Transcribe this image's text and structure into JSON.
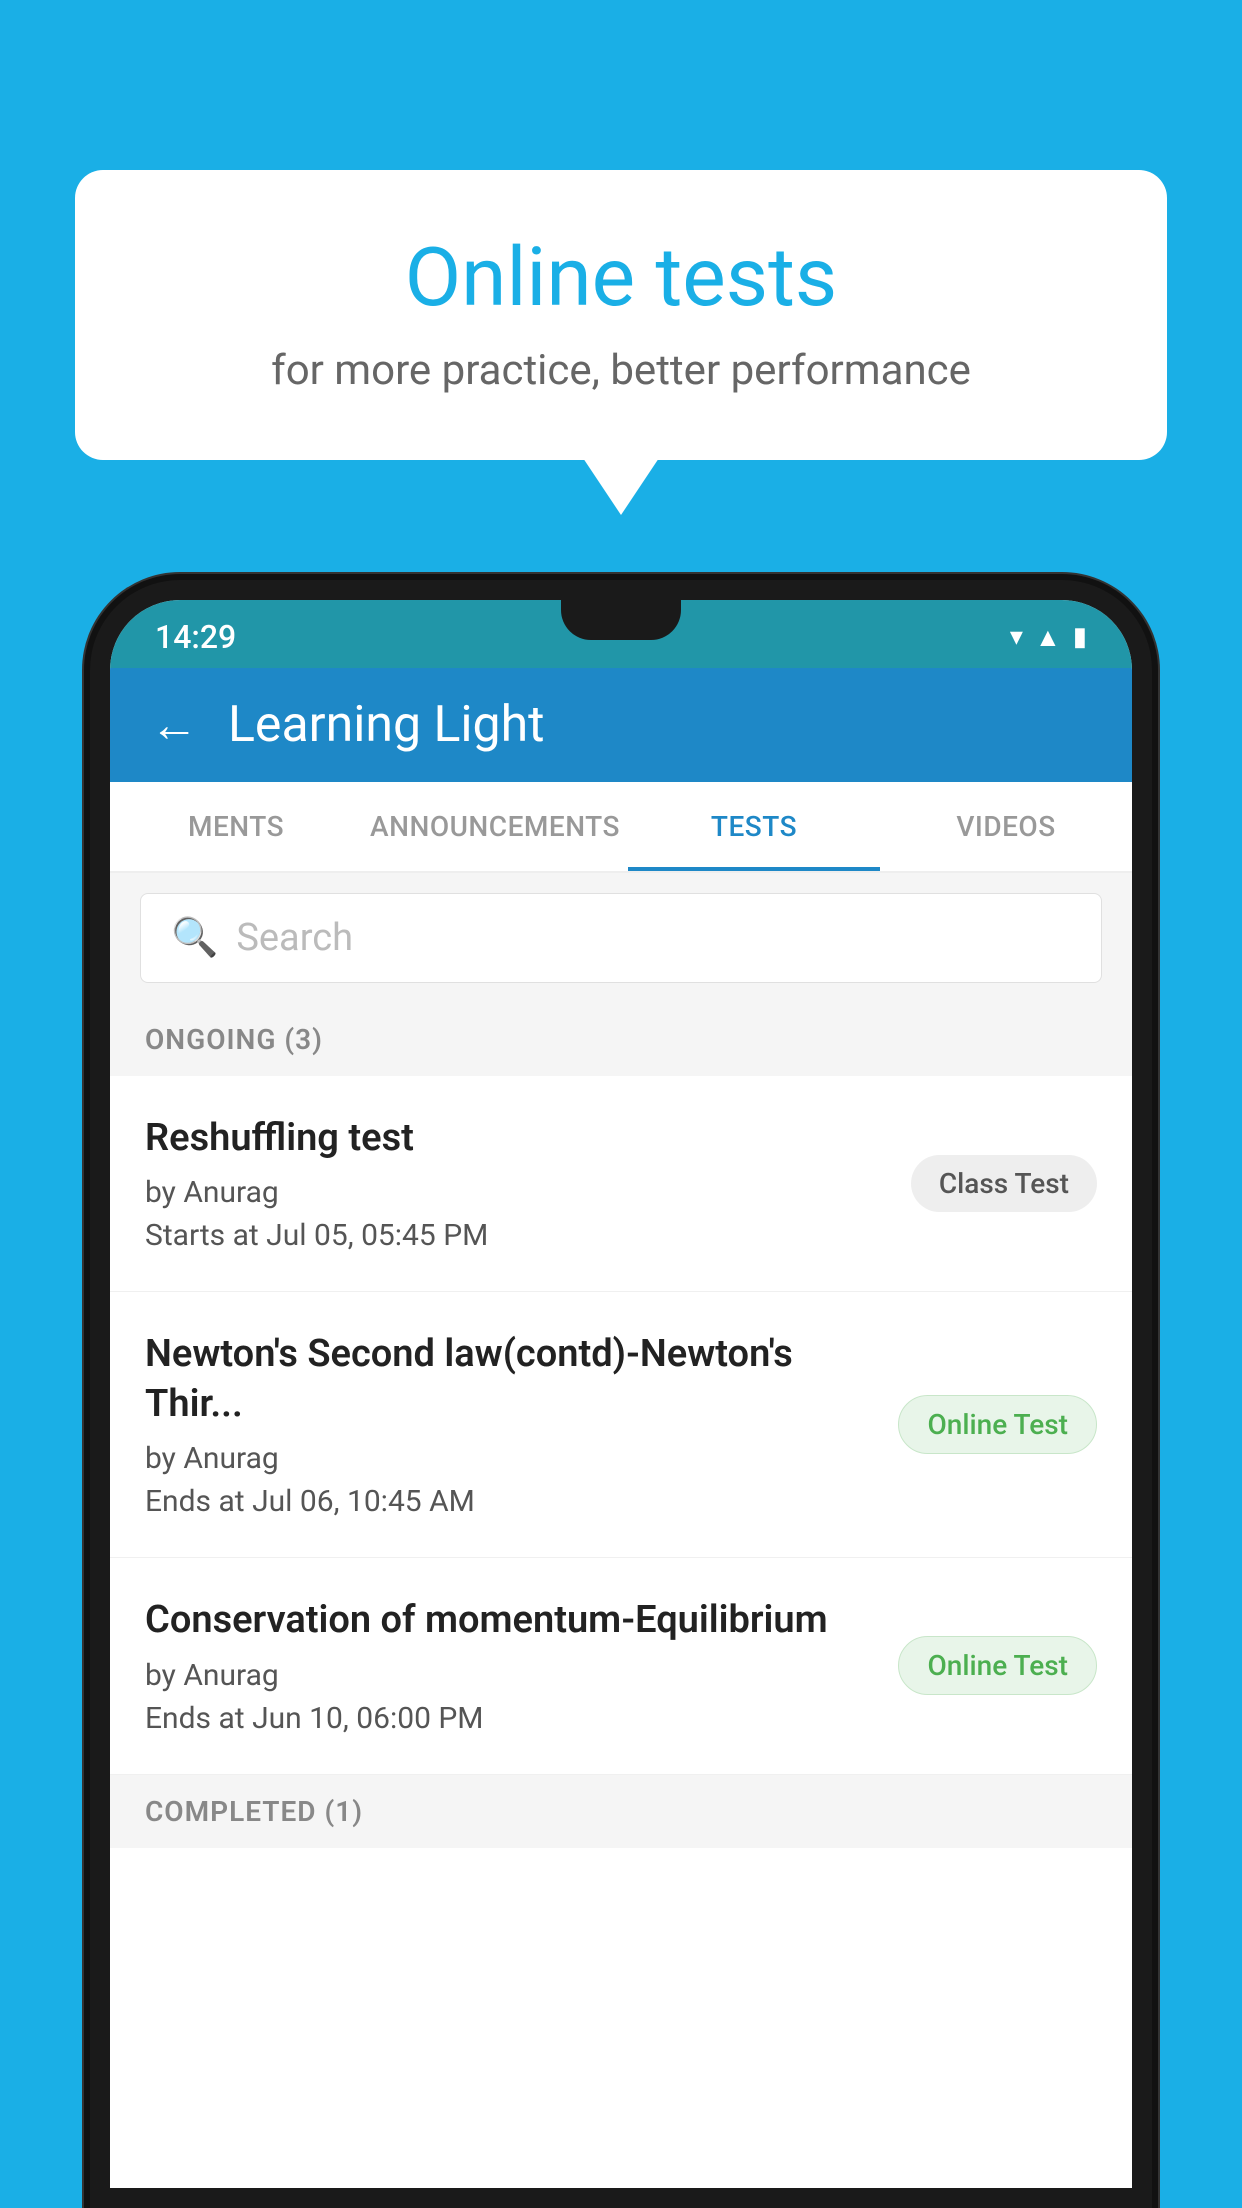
{
  "background": {
    "color": "#1AAFE6"
  },
  "speech_bubble": {
    "title": "Online tests",
    "subtitle": "for more practice, better performance"
  },
  "phone": {
    "status_bar": {
      "time": "14:29",
      "icons": [
        "wifi",
        "signal",
        "battery"
      ]
    },
    "app_bar": {
      "back_label": "←",
      "title": "Learning Light"
    },
    "tabs": [
      {
        "label": "MENTS",
        "active": false
      },
      {
        "label": "ANNOUNCEMENTS",
        "active": false
      },
      {
        "label": "TESTS",
        "active": true
      },
      {
        "label": "VIDEOS",
        "active": false
      }
    ],
    "search": {
      "placeholder": "Search"
    },
    "ongoing_section": {
      "title": "ONGOING (3)"
    },
    "test_items": [
      {
        "name": "Reshuffling test",
        "author": "by Anurag",
        "time_label": "Starts at",
        "time": "Jul 05, 05:45 PM",
        "badge": "Class Test",
        "badge_type": "class"
      },
      {
        "name": "Newton's Second law(contd)-Newton's Thir...",
        "author": "by Anurag",
        "time_label": "Ends at",
        "time": "Jul 06, 10:45 AM",
        "badge": "Online Test",
        "badge_type": "online"
      },
      {
        "name": "Conservation of momentum-Equilibrium",
        "author": "by Anurag",
        "time_label": "Ends at",
        "time": "Jun 10, 06:00 PM",
        "badge": "Online Test",
        "badge_type": "online"
      }
    ],
    "completed_section": {
      "title": "COMPLETED (1)"
    }
  }
}
